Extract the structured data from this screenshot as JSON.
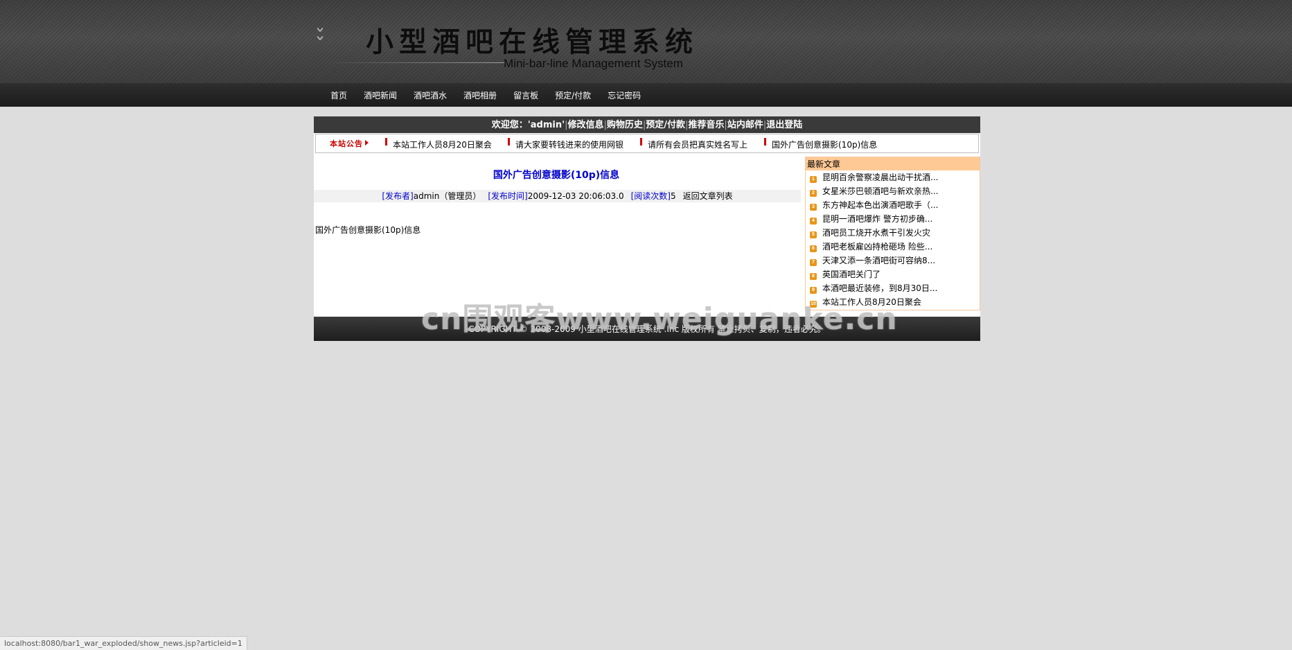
{
  "header": {
    "title": "小型酒吧在线管理系统",
    "subtitle": "Mini-bar-line Management System"
  },
  "nav": {
    "items": [
      "首页",
      "酒吧新闻",
      "酒吧酒水",
      "酒吧相册",
      "留言板",
      "预定/付款",
      "忘记密码"
    ]
  },
  "user_bar": {
    "welcome": "欢迎您：'admin'",
    "links": [
      "修改信息",
      "购物历史",
      "预定/付款",
      "推荐音乐",
      "站内邮件",
      "退出登陆"
    ]
  },
  "notice": {
    "label": "本站公告",
    "items": [
      "本站工作人员8月20日聚会",
      "请大家要转钱进来的使用网银",
      "请所有会员把真实姓名写上",
      "国外广告创意摄影(10p)信息"
    ]
  },
  "article": {
    "title": "国外广告创意摄影(10p)信息",
    "publisher_label": "[发布者]",
    "publisher_value": "admin（管理员）",
    "time_label": "[发布时间]",
    "time_value": "2009-12-03 20:06:03.0",
    "views_label": "[阅读次数]",
    "views_value": "5",
    "back_link": "返回文章列表",
    "body": "国外广告创意摄影(10p)信息"
  },
  "latest": {
    "header": "最新文章",
    "items": [
      {
        "num": "1",
        "title": "昆明百余警察凌晨出动干扰酒..."
      },
      {
        "num": "2",
        "title": "女星米莎巴顿酒吧与新欢亲热..."
      },
      {
        "num": "3",
        "title": "东方神起本色出演酒吧歌手（..."
      },
      {
        "num": "4",
        "title": "昆明一酒吧爆炸 警方初步确..."
      },
      {
        "num": "5",
        "title": "酒吧员工烧开水煮干引发火灾"
      },
      {
        "num": "6",
        "title": "酒吧老板雇凶持枪砸场 险些..."
      },
      {
        "num": "7",
        "title": "天津又添一条酒吧街可容纳8..."
      },
      {
        "num": "8",
        "title": "英国酒吧关门了"
      },
      {
        "num": "9",
        "title": "本酒吧最近装修，到8月30日..."
      },
      {
        "num": "10",
        "title": "本站工作人员8月20日聚会"
      }
    ]
  },
  "footer": {
    "text": "COPYRIGHT © 2008-2009    小型酒吧在线管理系统 .Inc 版权所有 禁止拷贝、复制，违者必究。"
  },
  "watermark": "cn围观客www.weiguanke.cn",
  "status_url": "localhost:8080/bar1_war_exploded/show_news.jsp?articleid=1",
  "colors": {
    "link_blue": "#0000cc",
    "notice_red": "#cc0000",
    "sidebar_header": "#ffc996",
    "badge_orange": "#e7961b"
  }
}
